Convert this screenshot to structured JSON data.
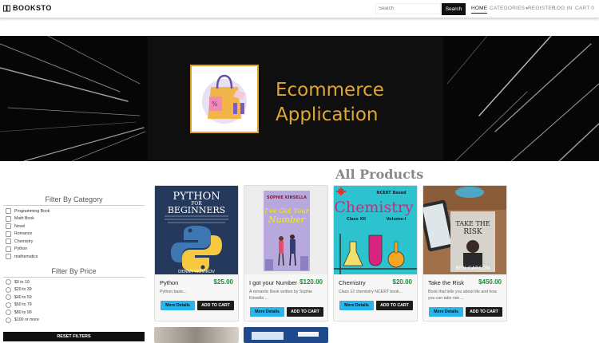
{
  "brand": {
    "name": "BOOKSTO",
    "icon": "book-icon"
  },
  "search": {
    "placeholder": "Search",
    "button_label": "Search"
  },
  "nav": {
    "home": "HOME",
    "categories": "CATEGORIES",
    "register": "REGISTER",
    "login": "LOG IN",
    "cart": "CART 0"
  },
  "banner": {
    "line1": "Ecommerce",
    "line2": "Application"
  },
  "products_title": "All Products",
  "category_filter": {
    "title": "Filter By Category",
    "items": [
      "Programming Book",
      "Math Book",
      "Novel",
      "Romance",
      "Chemistry",
      "Python",
      "mathematics"
    ]
  },
  "price_filter": {
    "title": "Filter By Price",
    "items": [
      "$0 to 19",
      "$20 to 39",
      "$40 to 59",
      "$60 to 79",
      "$80 to 99",
      "$100 or more"
    ]
  },
  "reset_label": "RESET FILTERS",
  "product_buttons": {
    "details": "More Details",
    "add_to_cart": "ADD TO CART"
  },
  "products": [
    {
      "name": "Python",
      "price": "$25.00",
      "description": "Python basic...",
      "cover": {
        "title_top": "PYTHON",
        "title_mid": "FOR",
        "title_bottom": "BEGINNERS",
        "author": "DENNY NOVIKOV"
      }
    },
    {
      "name": "I got your Number",
      "price": "$120.00",
      "description": "A romantic Book written by Sophie Kinsella ...",
      "cover": {
        "author": "SOPHIE KINSELLA",
        "title_a": "I've Got Your",
        "title_b": "Number"
      }
    },
    {
      "name": "Chemistry",
      "price": "$20.00",
      "description": "Class 12 chemistry NCERT book...",
      "cover": {
        "series": "NCERT Based",
        "title": "Chemistry",
        "volume": "Volume-I",
        "class": "Class XII"
      }
    },
    {
      "name": "Take the Risk",
      "price": "$450.00",
      "description": "Book that tells you about life and how you can take risk ...",
      "cover": {
        "title_a": "TAKE THE",
        "title_b": "RISK",
        "author": "BEN CARSON"
      }
    }
  ],
  "colors": {
    "price": "#1f8a3a",
    "details_button": "#29b5e8",
    "banner_text": "#e2a630"
  }
}
